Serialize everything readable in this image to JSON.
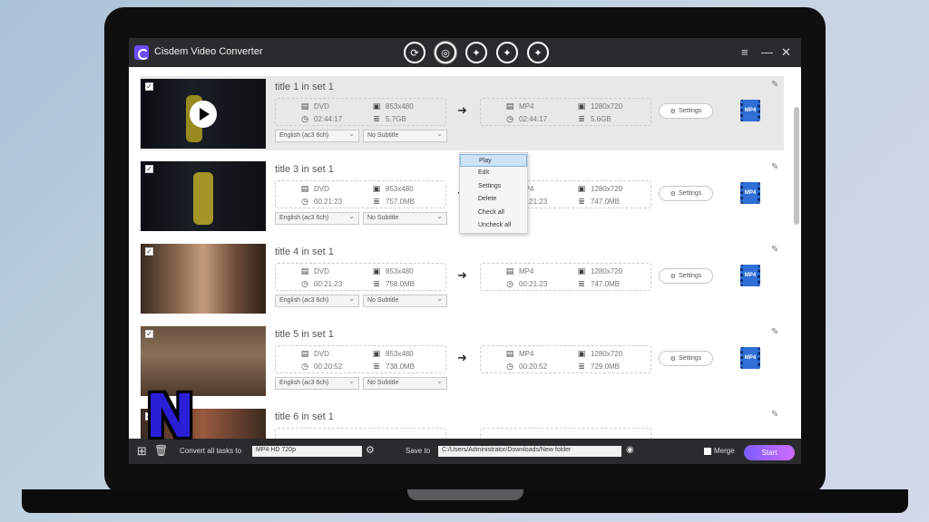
{
  "app": {
    "title": "Cisdem Video Converter",
    "toolbar_icons": [
      "convert-icon",
      "rip-icon",
      "download-icon",
      "burn-icon",
      "more-icon"
    ],
    "window_controls": {
      "menu": "≡",
      "minimize": "—",
      "close": "✕"
    }
  },
  "rows": [
    {
      "title": "title 1 in set 1",
      "checked": true,
      "selected": true,
      "src_format": "DVD",
      "src_res": "853x480",
      "src_duration": "02:44:17",
      "src_size": "5.7GB",
      "dst_format": "MP4",
      "dst_res": "1280x720",
      "dst_duration": "02:44:17",
      "dst_size": "5.6GB",
      "audio": "English (ac3 6ch)",
      "subtitle": "No Subtitle",
      "settings_label": "Settings",
      "badge": "MP4"
    },
    {
      "title": "title 3 in set 1",
      "checked": true,
      "selected": false,
      "src_format": "DVD",
      "src_res": "853x480",
      "src_duration": "00:21:23",
      "src_size": "757.0MB",
      "dst_format": "MP4",
      "dst_res": "1280x720",
      "dst_duration": "00:21:23",
      "dst_size": "747.0MB",
      "audio": "English (ac3 6ch)",
      "subtitle": "No Subtitle",
      "settings_label": "Settings",
      "badge": "MP4"
    },
    {
      "title": "title 4 in set 1",
      "checked": true,
      "selected": false,
      "src_format": "DVD",
      "src_res": "853x480",
      "src_duration": "00:21:23",
      "src_size": "758.0MB",
      "dst_format": "MP4",
      "dst_res": "1280x720",
      "dst_duration": "00:21:23",
      "dst_size": "747.0MB",
      "audio": "English (ac3 6ch)",
      "subtitle": "No Subtitle",
      "settings_label": "Settings",
      "badge": "MP4"
    },
    {
      "title": "title 5 in set 1",
      "checked": true,
      "selected": false,
      "src_format": "DVD",
      "src_res": "853x480",
      "src_duration": "00:20:52",
      "src_size": "738.0MB",
      "dst_format": "MP4",
      "dst_res": "1280x720",
      "dst_duration": "00:20:52",
      "dst_size": "729.0MB",
      "audio": "English (ac3 6ch)",
      "subtitle": "No Subtitle",
      "settings_label": "Settings",
      "badge": "MP4"
    },
    {
      "title": "title 6 in set 1",
      "checked": true,
      "selected": false
    }
  ],
  "context_menu": [
    "Play",
    "Edit",
    "Settings",
    "Delete",
    "Check all",
    "Uncheck all"
  ],
  "bottom": {
    "convert_all_label": "Convert all tasks to",
    "convert_all_value": "MP4 HD 720p",
    "save_to_label": "Save to",
    "save_path": "C:/Users/Administrator/Downloads/New folder",
    "merge_label": "Merge",
    "start_label": "Start"
  },
  "watermark": "N",
  "colors": {
    "accent": "#7b5cff",
    "titlebar": "#2b2b2e",
    "selected_row": "#e8e8e8"
  }
}
